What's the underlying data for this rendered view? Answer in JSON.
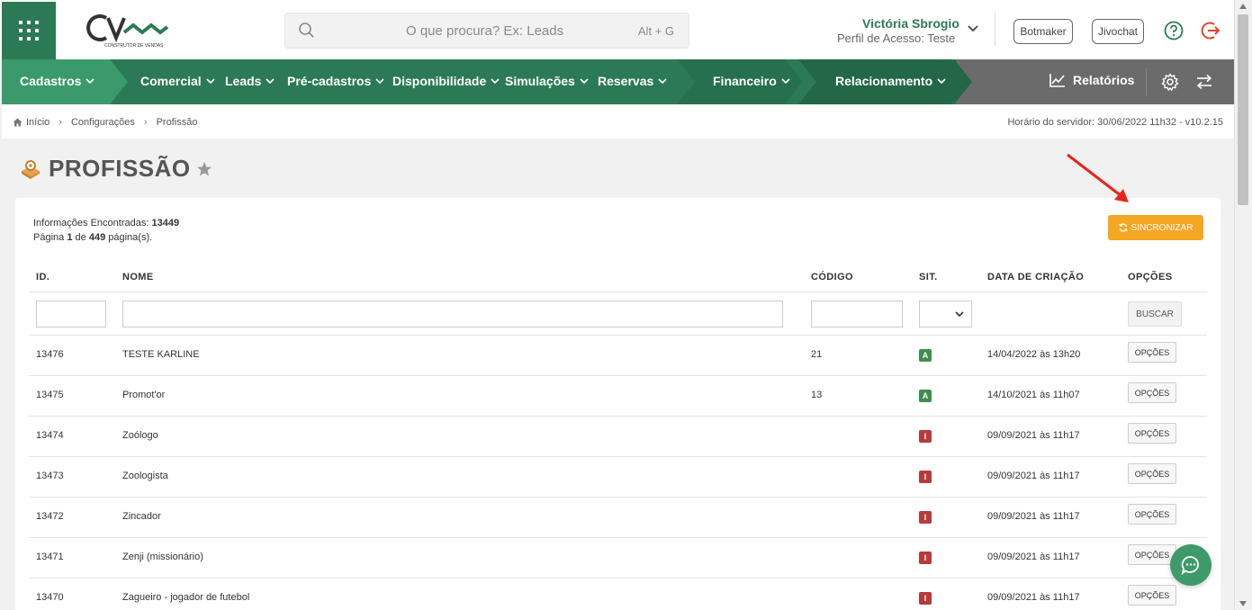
{
  "header": {
    "search_placeholder": "O que procura? Ex: Leads",
    "search_shortcut": "Alt + G",
    "user_name": "Victória Sbrogio",
    "user_profile": "Perfil de Acesso: Teste",
    "botmaker": "Botmaker",
    "jivochat": "Jivochat"
  },
  "nav": {
    "items": [
      "Cadastros",
      "Comercial",
      "Leads",
      "Pré-cadastros",
      "Disponibilidade",
      "Simulações",
      "Reservas",
      "Financeiro",
      "Relacionamento"
    ],
    "reports": "Relatórios"
  },
  "breadcrumb": {
    "home": "Início",
    "config": "Configurações",
    "current": "Profissão",
    "server_time": "Horário do servidor: 30/06/2022 11h32 - v10.2.15"
  },
  "page": {
    "title": "PROFISSÃO",
    "found_label": "Informações Encontradas:",
    "found_count": "13449",
    "page_label": "Página",
    "page_current": "1",
    "page_of": "de",
    "page_total": "449",
    "page_suffix": "página(s).",
    "sync_label": "SINCRONIZAR"
  },
  "table": {
    "headers": {
      "id": "ID.",
      "name": "NOME",
      "code": "CÓDIGO",
      "sit": "SIT.",
      "date": "DATA DE CRIAÇÃO",
      "options": "OPÇÕES"
    },
    "search_label": "BUSCAR",
    "options_label": "OPÇÕES",
    "rows": [
      {
        "id": "13476",
        "name": "TESTE KARLINE",
        "code": "21",
        "sit": "A",
        "date": "14/04/2022 às 13h20"
      },
      {
        "id": "13475",
        "name": "Promot'or",
        "code": "13",
        "sit": "A",
        "date": "14/10/2021 às 11h07"
      },
      {
        "id": "13474",
        "name": "Zoólogo",
        "code": "",
        "sit": "I",
        "date": "09/09/2021 às 11h17"
      },
      {
        "id": "13473",
        "name": "Zoologista",
        "code": "",
        "sit": "I",
        "date": "09/09/2021 às 11h17"
      },
      {
        "id": "13472",
        "name": "Zincador",
        "code": "",
        "sit": "I",
        "date": "09/09/2021 às 11h17"
      },
      {
        "id": "13471",
        "name": "Zenji (missionário)",
        "code": "",
        "sit": "I",
        "date": "09/09/2021 às 11h17"
      },
      {
        "id": "13470",
        "name": "Zagueiro - jogador de futebol",
        "code": "",
        "sit": "I",
        "date": "09/09/2021 às 11h17"
      }
    ]
  },
  "colors": {
    "brand_green": "#2c7a55",
    "nav_grey": "#6b6b6b",
    "sync_orange": "#f5a623",
    "active_badge": "#3e8e4f",
    "inactive_badge": "#b83b3b",
    "logout_red": "#e0442b"
  }
}
